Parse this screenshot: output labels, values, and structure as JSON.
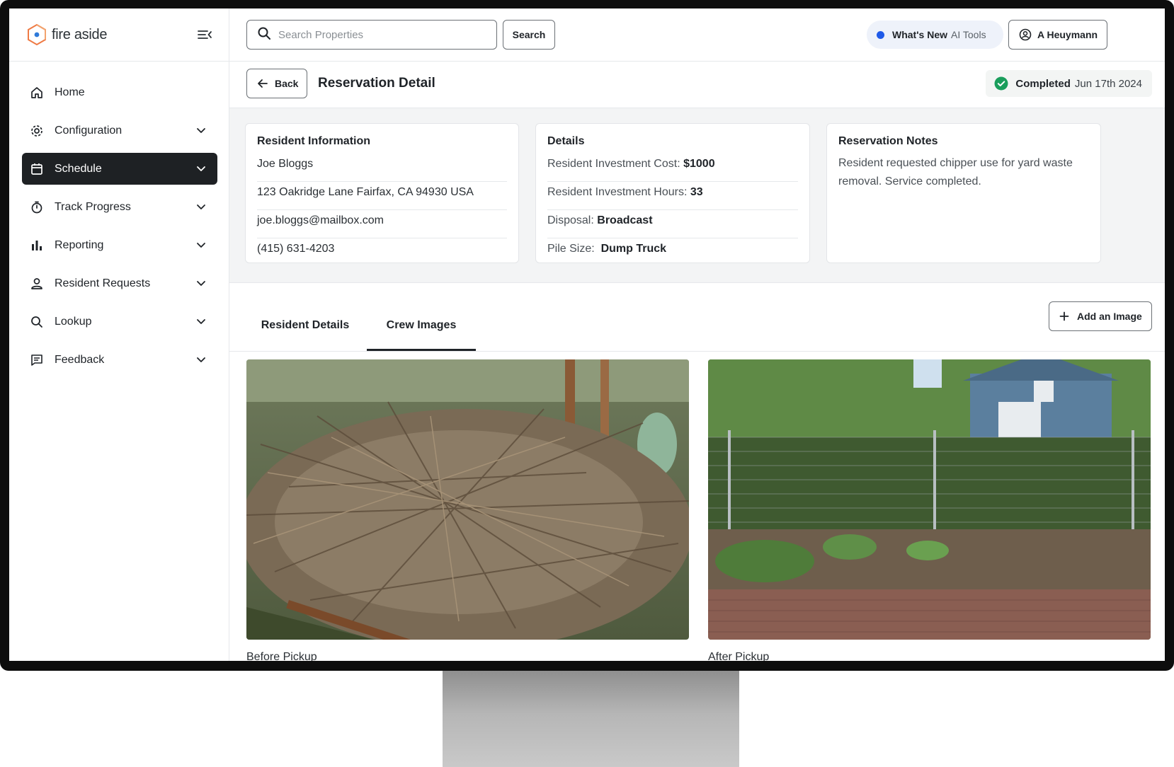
{
  "app": {
    "name": "fire aside"
  },
  "sidebar": {
    "items": [
      {
        "label": "Home",
        "icon": "home-icon",
        "has_chevron": false,
        "active": false
      },
      {
        "label": "Configuration",
        "icon": "gear-icon",
        "has_chevron": true,
        "active": false
      },
      {
        "label": "Schedule",
        "icon": "calendar-icon",
        "has_chevron": true,
        "active": true
      },
      {
        "label": "Track Progress",
        "icon": "stopwatch-icon",
        "has_chevron": true,
        "active": false
      },
      {
        "label": "Reporting",
        "icon": "bar-chart-icon",
        "has_chevron": true,
        "active": false
      },
      {
        "label": "Resident Requests",
        "icon": "person-icon",
        "has_chevron": true,
        "active": false
      },
      {
        "label": "Lookup",
        "icon": "search-icon",
        "has_chevron": true,
        "active": false
      },
      {
        "label": "Feedback",
        "icon": "message-icon",
        "has_chevron": true,
        "active": false
      }
    ]
  },
  "topbar": {
    "search_placeholder": "Search Properties",
    "search_value": "",
    "search_button": "Search",
    "whats_new_bold": "What's New",
    "whats_new_rest": "AI Tools",
    "user_name": "A Heuymann"
  },
  "header": {
    "back_label": "Back",
    "title": "Reservation Detail",
    "status_label": "Completed",
    "status_date": "Jun 17th 2024"
  },
  "resident_info": {
    "title": "Resident Information",
    "name": "Joe Bloggs",
    "address": "123 Oakridge Lane Fairfax, CA 94930 USA",
    "email": "joe.bloggs@mailbox.com",
    "phone": "(415) 631-4203"
  },
  "details": {
    "title": "Details",
    "rows": [
      {
        "key": "Resident Investment Cost:",
        "value": "$1000"
      },
      {
        "key": "Resident Investment Hours:",
        "value": "33"
      },
      {
        "key": "Disposal:",
        "value": "Broadcast"
      },
      {
        "key": "Pile Size:",
        "value": "Dump Truck"
      }
    ]
  },
  "notes": {
    "title": "Reservation Notes",
    "text": "Resident requested chipper use for yard waste removal. Service completed."
  },
  "tabs": {
    "items": [
      {
        "label": "Resident Details",
        "active": false
      },
      {
        "label": "Crew Images",
        "active": true
      }
    ],
    "add_image_label": "Add an Image"
  },
  "images": [
    {
      "caption": "Before Pickup"
    },
    {
      "caption": "After Pickup"
    }
  ],
  "colors": {
    "active_nav_bg": "#1e2124",
    "accent_blue": "#1f5ae8",
    "success_green": "#1a9e5c",
    "logo_orange": "#ef7b45",
    "logo_blue": "#2f7ad9"
  }
}
